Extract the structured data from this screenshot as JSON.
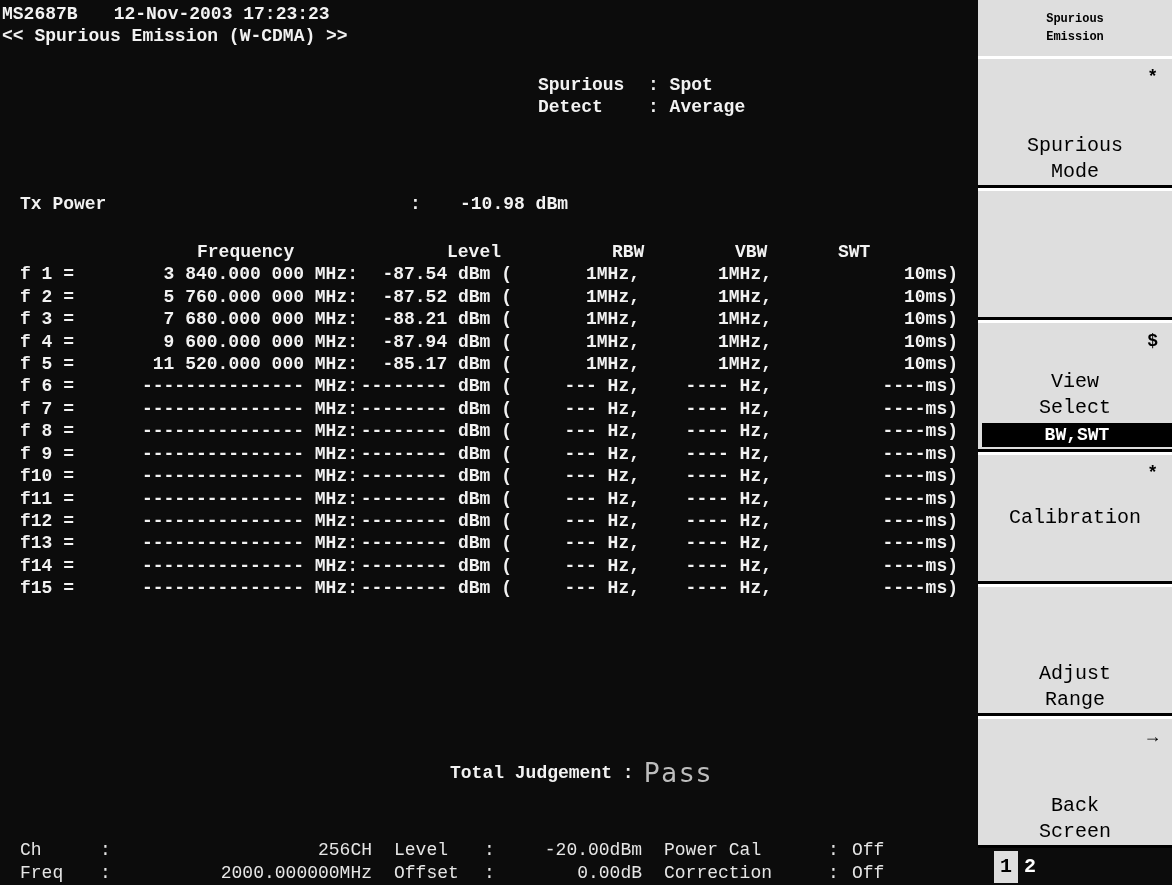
{
  "header": {
    "model": "MS2687B",
    "datetime": "12-Nov-2003 17:23:23",
    "title": "<< Spurious Emission (W-CDMA) >>"
  },
  "settings": [
    {
      "label": "Spurious",
      "value": ": Spot"
    },
    {
      "label": "Detect",
      "value": ": Average"
    }
  ],
  "tx_power": {
    "label": "Tx Power",
    "separator": ":",
    "value": "-10.98 dBm"
  },
  "table": {
    "columns": [
      "Frequency",
      "Level",
      "RBW",
      "VBW",
      "SWT"
    ],
    "rows": [
      {
        "label": "f 1 =",
        "frequency": "3 840.000 000 MHz:",
        "level": "-87.54 dBm (",
        "rbw": "1MHz,",
        "vbw": "1MHz,",
        "swt": "10ms)"
      },
      {
        "label": "f 2 =",
        "frequency": "5 760.000 000 MHz:",
        "level": "-87.52 dBm (",
        "rbw": "1MHz,",
        "vbw": "1MHz,",
        "swt": "10ms)"
      },
      {
        "label": "f 3 =",
        "frequency": "7 680.000 000 MHz:",
        "level": "-88.21 dBm (",
        "rbw": "1MHz,",
        "vbw": "1MHz,",
        "swt": "10ms)"
      },
      {
        "label": "f 4 =",
        "frequency": "9 600.000 000 MHz:",
        "level": "-87.94 dBm (",
        "rbw": "1MHz,",
        "vbw": "1MHz,",
        "swt": "10ms)"
      },
      {
        "label": "f 5 =",
        "frequency": "11 520.000 000 MHz:",
        "level": "-85.17 dBm (",
        "rbw": "1MHz,",
        "vbw": "1MHz,",
        "swt": "10ms)"
      },
      {
        "label": "f 6 =",
        "frequency": "--------------- MHz:",
        "level": "-------- dBm (",
        "rbw": "--- Hz,",
        "vbw": "---- Hz,",
        "swt": "----ms)"
      },
      {
        "label": "f 7 =",
        "frequency": "--------------- MHz:",
        "level": "-------- dBm (",
        "rbw": "--- Hz,",
        "vbw": "---- Hz,",
        "swt": "----ms)"
      },
      {
        "label": "f 8 =",
        "frequency": "--------------- MHz:",
        "level": "-------- dBm (",
        "rbw": "--- Hz,",
        "vbw": "---- Hz,",
        "swt": "----ms)"
      },
      {
        "label": "f 9 =",
        "frequency": "--------------- MHz:",
        "level": "-------- dBm (",
        "rbw": "--- Hz,",
        "vbw": "---- Hz,",
        "swt": "----ms)"
      },
      {
        "label": "f10 =",
        "frequency": "--------------- MHz:",
        "level": "-------- dBm (",
        "rbw": "--- Hz,",
        "vbw": "---- Hz,",
        "swt": "----ms)"
      },
      {
        "label": "f11 =",
        "frequency": "--------------- MHz:",
        "level": "-------- dBm (",
        "rbw": "--- Hz,",
        "vbw": "---- Hz,",
        "swt": "----ms)"
      },
      {
        "label": "f12 =",
        "frequency": "--------------- MHz:",
        "level": "-------- dBm (",
        "rbw": "--- Hz,",
        "vbw": "---- Hz,",
        "swt": "----ms)"
      },
      {
        "label": "f13 =",
        "frequency": "--------------- MHz:",
        "level": "-------- dBm (",
        "rbw": "--- Hz,",
        "vbw": "---- Hz,",
        "swt": "----ms)"
      },
      {
        "label": "f14 =",
        "frequency": "--------------- MHz:",
        "level": "-------- dBm (",
        "rbw": "--- Hz,",
        "vbw": "---- Hz,",
        "swt": "----ms)"
      },
      {
        "label": "f15 =",
        "frequency": "--------------- MHz:",
        "level": "-------- dBm (",
        "rbw": "--- Hz,",
        "vbw": "---- Hz,",
        "swt": "----ms)"
      }
    ]
  },
  "judgement": {
    "label": "Total Judgement :",
    "value": "Pass"
  },
  "status": [
    {
      "label": "Ch",
      "separator": ":",
      "value": "256CH"
    },
    {
      "label": "Level",
      "separator": ":",
      "value": "-20.00dBm"
    },
    {
      "label": "Power Cal",
      "separator": ":",
      "value": "Off"
    },
    {
      "label": "Freq",
      "separator": ":",
      "value": "2000.000000MHz"
    },
    {
      "label": "Offset",
      "separator": ":",
      "value": "0.00dB"
    },
    {
      "label": "Correction",
      "separator": ":",
      "value": "Off"
    }
  ],
  "softkeys": {
    "title": [
      "Spurious",
      "Emission"
    ],
    "keys": [
      {
        "kind": "key",
        "mark": "*",
        "lines": [
          "Spurious",
          "Mode"
        ]
      },
      {
        "kind": "blank"
      },
      {
        "kind": "key",
        "mark": "$",
        "lines": [
          "View",
          "Select"
        ],
        "sub": "BW,SWT"
      },
      {
        "kind": "key",
        "mark": "*",
        "lines": [
          "Calibration"
        ]
      },
      {
        "kind": "key",
        "lines": [
          "Adjust",
          "Range"
        ]
      },
      {
        "kind": "key",
        "mark": "→",
        "lines": [
          "Back",
          "Screen"
        ]
      }
    ],
    "pages": [
      {
        "label": "1",
        "selected": true
      },
      {
        "label": "2",
        "selected": false
      }
    ]
  }
}
